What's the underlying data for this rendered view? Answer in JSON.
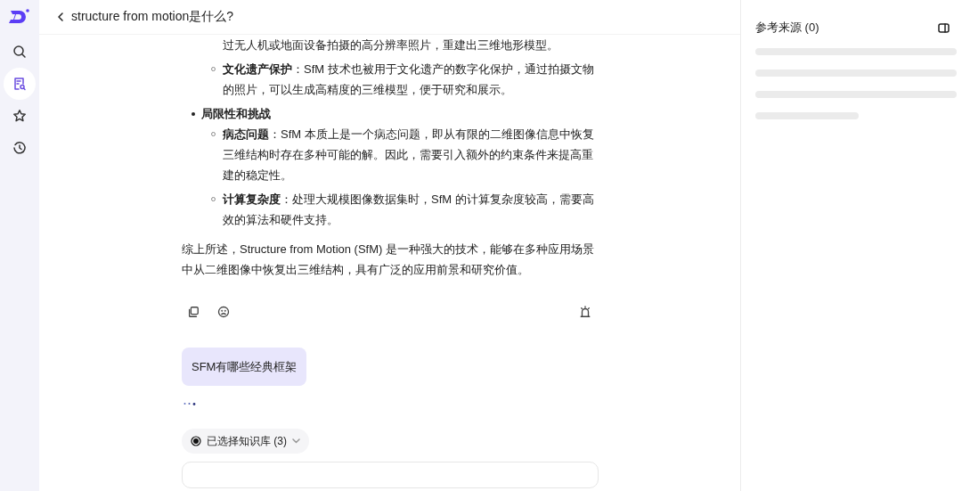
{
  "sidebar": {
    "items": [
      {
        "kind": "search",
        "selected": false
      },
      {
        "kind": "knowledge",
        "selected": true
      },
      {
        "kind": "star",
        "selected": false
      },
      {
        "kind": "history",
        "selected": false
      }
    ]
  },
  "header": {
    "title": "structure from motion是什么?"
  },
  "answer": {
    "list": [
      {
        "children": [
          {
            "kind": "continuation",
            "text": "过无人机或地面设备拍摄的高分辨率照片，重建出三维地形模型。"
          },
          {
            "kind": "item",
            "text": "**文化遗产保护**：SfM 技术也被用于文化遗产的数字化保护，通过拍摄文物的照片，可以生成高精度的三维模型，便于研究和展示。"
          }
        ]
      },
      {
        "text": "局限性和挑战",
        "children": [
          {
            "kind": "item",
            "text": "**病态问题**：SfM 本质上是一个病态问题，即从有限的二维图像信息中恢复三维结构时存在多种可能的解。因此，需要引入额外的约束条件来提高重建的稳定性。"
          },
          {
            "kind": "item",
            "text": "**计算复杂度**：处理大规模图像数据集时，SfM 的计算复杂度较高，需要高效的算法和硬件支持。"
          }
        ]
      }
    ],
    "summary": "综上所述，Structure from Motion (SfM) 是一种强大的技术，能够在多种应用场景中从二维图像中恢复出三维结构，具有广泛的应用前景和研究价值。",
    "actions": [
      {
        "kind": "copy"
      },
      {
        "kind": "dislike"
      },
      {
        "kind": "report"
      }
    ]
  },
  "question": "SFM有哪些经典框架",
  "knowledge_selector": {
    "label": "已选择知识库 (3)"
  },
  "references": {
    "title": "参考来源 (0)"
  }
}
